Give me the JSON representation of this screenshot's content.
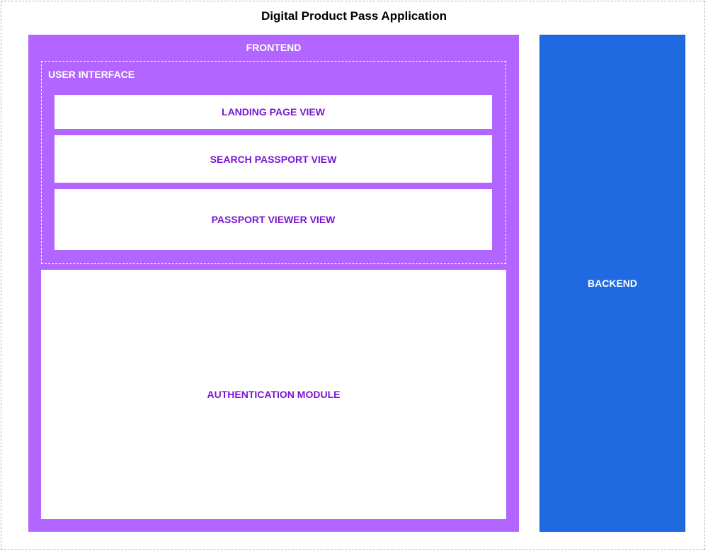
{
  "diagram": {
    "title": "Digital Product Pass Application",
    "frontend": {
      "label": "FRONTEND",
      "user_interface": {
        "label": "USER INTERFACE",
        "views": [
          "LANDING PAGE VIEW",
          "SEARCH PASSPORT VIEW",
          "PASSPORT VIEWER VIEW"
        ]
      },
      "authentication_module": "AUTHENTICATION MODULE"
    },
    "backend": {
      "label": "BACKEND"
    }
  },
  "colors": {
    "frontend": "#b266ff",
    "backend": "#1f6ae0",
    "inner_text": "#7a16d3"
  }
}
